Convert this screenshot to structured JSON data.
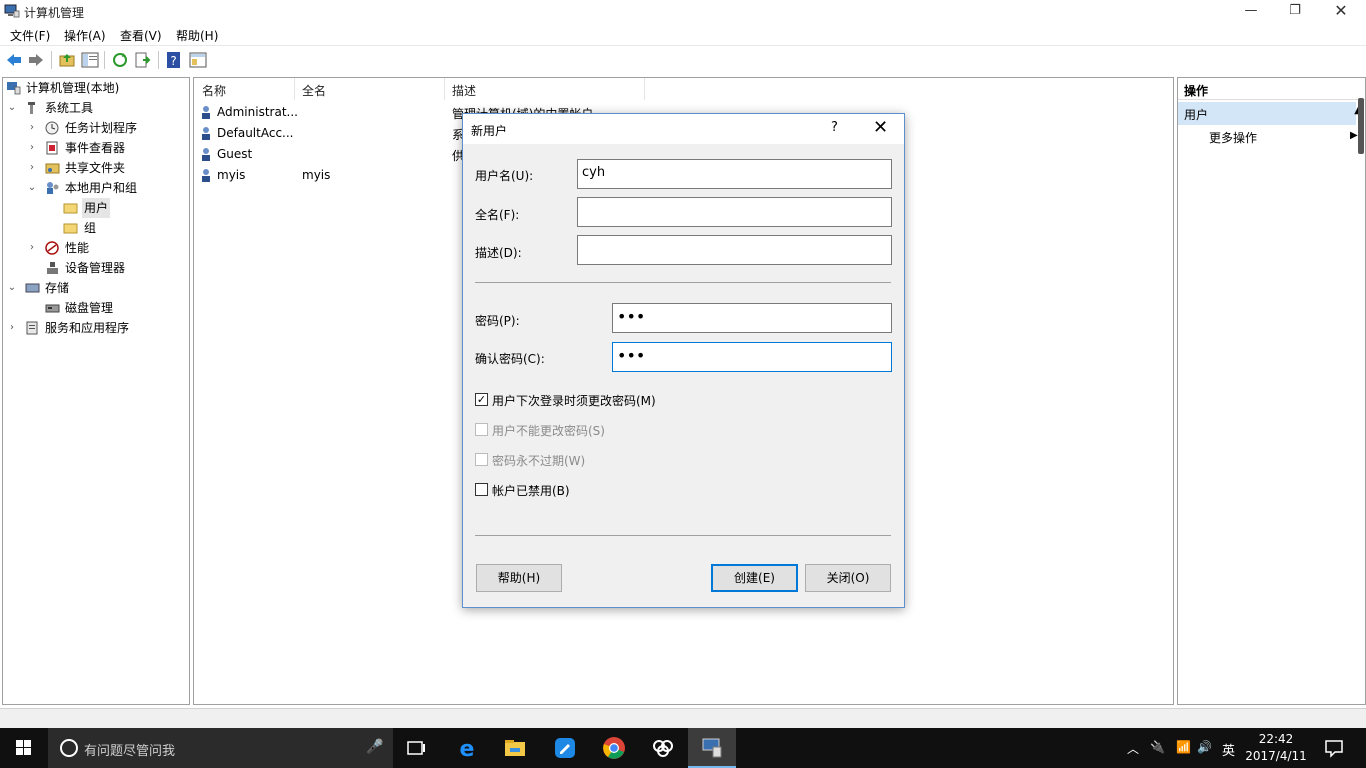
{
  "window": {
    "title": "计算机管理"
  },
  "menu": [
    "文件(F)",
    "操作(A)",
    "查看(V)",
    "帮助(H)"
  ],
  "tree": [
    {
      "label": "计算机管理(本地)"
    },
    {
      "label": "系统工具"
    },
    {
      "label": "任务计划程序"
    },
    {
      "label": "事件查看器"
    },
    {
      "label": "共享文件夹"
    },
    {
      "label": "本地用户和组"
    },
    {
      "label": "用户"
    },
    {
      "label": "组"
    },
    {
      "label": "性能"
    },
    {
      "label": "设备管理器"
    },
    {
      "label": "存储"
    },
    {
      "label": "磁盘管理"
    },
    {
      "label": "服务和应用程序"
    }
  ],
  "list": {
    "columns": [
      "名称",
      "全名",
      "描述"
    ],
    "rows": [
      {
        "name": "Administrat...",
        "fullname": "",
        "desc": "管理计算机(域)的内置帐户"
      },
      {
        "name": "DefaultAcc...",
        "fullname": "",
        "desc": "系"
      },
      {
        "name": "Guest",
        "fullname": "",
        "desc": "供"
      },
      {
        "name": "myis",
        "fullname": "myis",
        "desc": ""
      }
    ]
  },
  "actions": {
    "title": "操作",
    "group": "用户",
    "more": "更多操作"
  },
  "dialog": {
    "title": "新用户",
    "help_glyph": "?",
    "close_glyph": "✕",
    "username_label": "用户名(U):",
    "username_value": "cyh",
    "fullname_label": "全名(F):",
    "fullname_value": "",
    "desc_label": "描述(D):",
    "desc_value": "",
    "password_label": "密码(P):",
    "password_value": "•••",
    "confirm_label": "确认密码(C):",
    "confirm_value": "•••",
    "checkboxes": [
      {
        "label": "用户下次登录时须更改密码(M)",
        "checked": true,
        "enabled": true
      },
      {
        "label": "用户不能更改密码(S)",
        "checked": false,
        "enabled": false
      },
      {
        "label": "密码永不过期(W)",
        "checked": false,
        "enabled": false
      },
      {
        "label": "帐户已禁用(B)",
        "checked": false,
        "enabled": true
      }
    ],
    "help_button": "帮助(H)",
    "create_button": "创建(E)",
    "close_button": "关闭(O)"
  },
  "taskbar": {
    "search_placeholder": "有问题尽管问我",
    "ime": "英",
    "time": "22:42",
    "date": "2017/4/11"
  },
  "colors": {
    "accent": "#0078d7",
    "selection": "#d3e6f7",
    "taskbar": "#101010"
  }
}
